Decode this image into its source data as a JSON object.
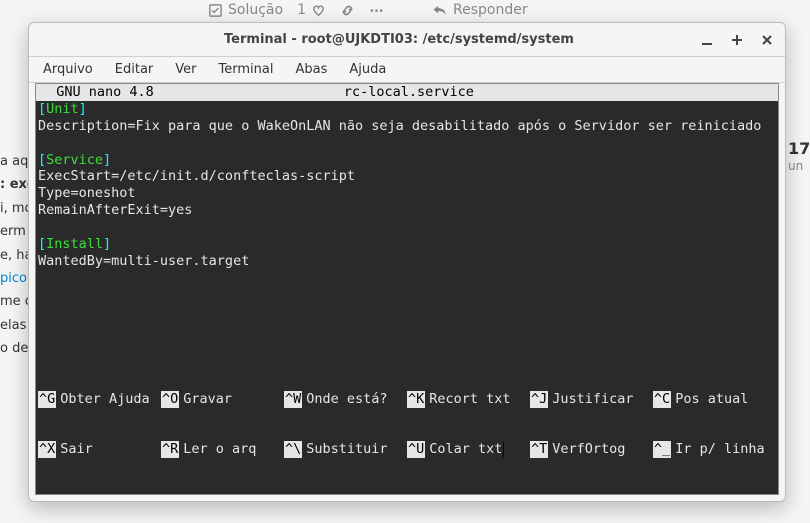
{
  "bg": {
    "solucao": "Solução",
    "likes_count": "1",
    "responder": "Responder",
    "left_lines": [
      "a aq",
      ": exe",
      "",
      "i, mo",
      "erm",
      "e, ha",
      "",
      "pico",
      "me c",
      "",
      "",
      "elas",
      "o de"
    ],
    "right_titlebold": "17",
    "right_sub": "un"
  },
  "window": {
    "title": "Terminal - root@UJKDTI03: /etc/systemd/system",
    "menu": [
      "Arquivo",
      "Editar",
      "Ver",
      "Terminal",
      "Abas",
      "Ajuda"
    ]
  },
  "nano": {
    "version": "  GNU nano 4.8",
    "filename": "rc-local.service",
    "sections": {
      "unit": "Unit",
      "service": "Service",
      "install": "Install"
    },
    "lines": {
      "description": "Description=Fix para que o WakeOnLAN não seja desabilitado após o Servidor ser reiniciado",
      "execstart": "ExecStart=/etc/init.d/confteclas-script",
      "type": "Type=oneshot",
      "remain": "RemainAfterExit=yes",
      "wantedby": "WantedBy=multi-user.target"
    },
    "footer": {
      "row1": [
        {
          "k": "^G",
          "l": "Obter Ajuda"
        },
        {
          "k": "^O",
          "l": "Gravar"
        },
        {
          "k": "^W",
          "l": "Onde está?"
        },
        {
          "k": "^K",
          "l": "Recort txt"
        },
        {
          "k": "^J",
          "l": "Justificar"
        },
        {
          "k": "^C",
          "l": "Pos atual"
        }
      ],
      "row2": [
        {
          "k": "^X",
          "l": "Sair"
        },
        {
          "k": "^R",
          "l": "Ler o arq"
        },
        {
          "k": "^\\",
          "l": "Substituir"
        },
        {
          "k": "^U",
          "l": "Colar txt"
        },
        {
          "k": "^T",
          "l": "VerfOrtog"
        },
        {
          "k": "^_",
          "l": "Ir p/ linha"
        }
      ]
    }
  },
  "icons": {
    "checkbox": "checkbox-icon",
    "heart": "heart-icon",
    "link": "link-icon",
    "dots": "dots-icon",
    "reply": "reply-icon",
    "minimize": "minimize-icon",
    "maximize": "maximize-icon",
    "close": "close-icon"
  }
}
